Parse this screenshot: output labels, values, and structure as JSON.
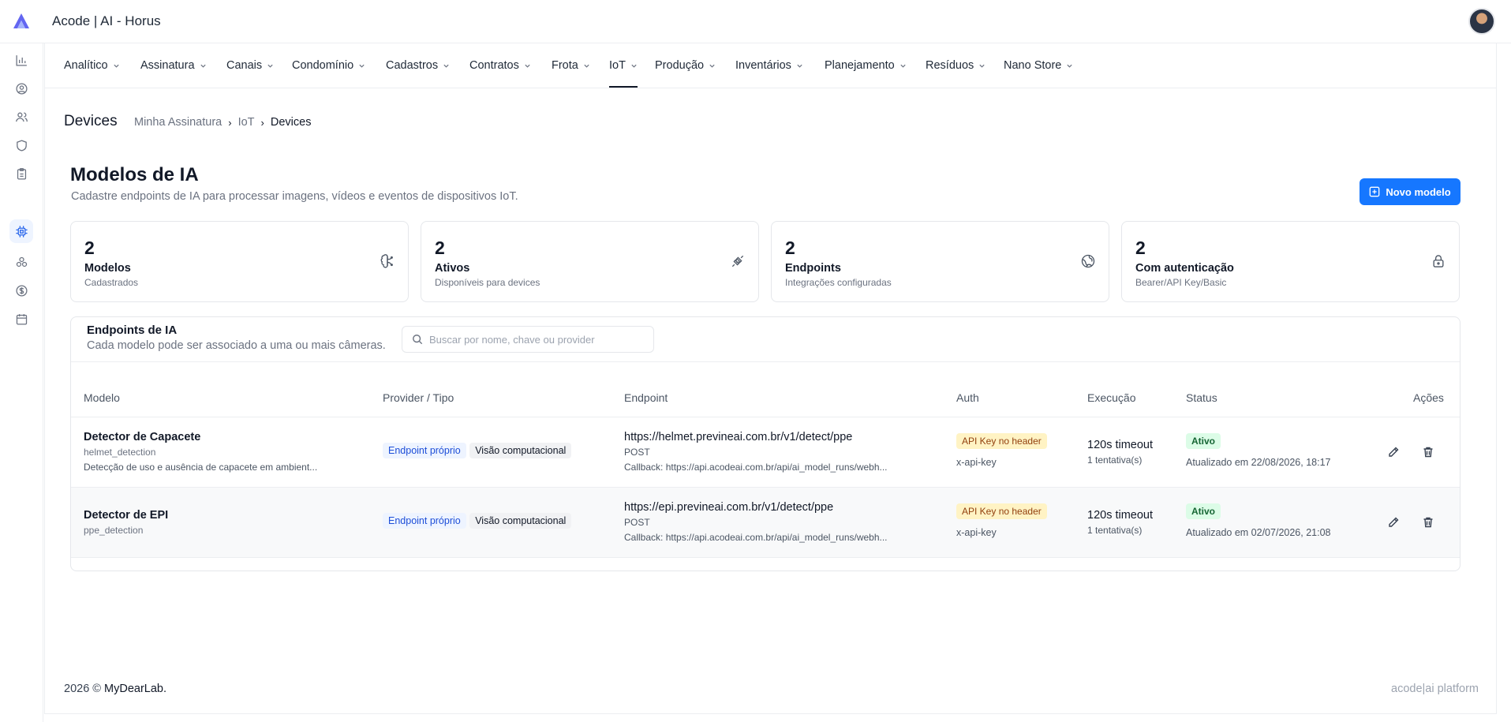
{
  "app": {
    "title": "Acode | AI - Horus"
  },
  "nav": {
    "items": [
      {
        "label": "Analítico"
      },
      {
        "label": "Assinatura"
      },
      {
        "label": "Canais"
      },
      {
        "label": "Condomínio"
      },
      {
        "label": "Cadastros"
      },
      {
        "label": "Contratos"
      },
      {
        "label": "Frota"
      },
      {
        "label": "IoT"
      },
      {
        "label": "Produção"
      },
      {
        "label": "Inventários"
      },
      {
        "label": "Planejamento"
      },
      {
        "label": "Resíduos"
      },
      {
        "label": "Nano Store"
      }
    ],
    "active": "IoT"
  },
  "sidebar": {
    "icons": [
      "bar-chart-icon",
      "user-circle-icon",
      "users-icon",
      "shield-icon",
      "clipboard-icon",
      "cpu-icon",
      "boxes-icon",
      "dollar-icon",
      "calendar-icon"
    ],
    "active": "cpu-icon"
  },
  "page": {
    "title": "Devices",
    "breadcrumb": [
      "Minha Assinatura",
      "IoT",
      "Devices"
    ]
  },
  "section": {
    "title": "Modelos de IA",
    "subtitle": "Cadastre endpoints de IA para processar imagens, vídeos e eventos de dispositivos IoT.",
    "new_button": "Novo modelo"
  },
  "stats": [
    {
      "value": "2",
      "label": "Modelos",
      "desc": "Cadastrados",
      "icon": "brain-icon"
    },
    {
      "value": "2",
      "label": "Ativos",
      "desc": "Disponíveis para devices",
      "icon": "plug-icon"
    },
    {
      "value": "2",
      "label": "Endpoints",
      "desc": "Integrações configuradas",
      "icon": "globe-icon"
    },
    {
      "value": "2",
      "label": "Com autenticação",
      "desc": "Bearer/API Key/Basic",
      "icon": "lock-icon"
    }
  ],
  "table": {
    "title": "Endpoints de IA",
    "subtitle": "Cada modelo pode ser associado a uma ou mais câmeras.",
    "search_placeholder": "Buscar por nome, chave ou provider",
    "columns": [
      "Modelo",
      "Provider / Tipo",
      "Endpoint",
      "Auth",
      "Execução",
      "Status",
      "Ações"
    ],
    "rows": [
      {
        "name": "Detector de Capacete",
        "key": "helmet_detection",
        "desc": "Detecção de uso e ausência de capacete em ambient...",
        "provider": "Endpoint próprio",
        "type": "Visão computacional",
        "url": "https://helmet.previneai.com.br/v1/detect/ppe",
        "method": "POST",
        "callback": "Callback: https://api.acodeai.com.br/api/ai_model_runs/webh...",
        "auth": "API Key no header",
        "auth_key": "x-api-key",
        "timeout": "120s timeout",
        "attempts": "1 tentativa(s)",
        "status": "Ativo",
        "updated": "Atualizado em 22/08/2026, 18:17"
      },
      {
        "name": "Detector de EPI",
        "key": "ppe_detection",
        "desc": "",
        "provider": "Endpoint próprio",
        "type": "Visão computacional",
        "url": "https://epi.previneai.com.br/v1/detect/ppe",
        "method": "POST",
        "callback": "Callback: https://api.acodeai.com.br/api/ai_model_runs/webh...",
        "auth": "API Key no header",
        "auth_key": "x-api-key",
        "timeout": "120s timeout",
        "attempts": "1 tentativa(s)",
        "status": "Ativo",
        "updated": "Atualizado em 02/07/2026, 21:08"
      }
    ]
  },
  "footer": {
    "year": "2026 ©",
    "brand": "MyDearLab.",
    "platform": "acode|ai platform"
  },
  "colors": {
    "accent": "#1677ff",
    "active_tab": "#111827",
    "status_green_bg": "#dcfce7",
    "auth_yellow_bg": "#fff3c4"
  }
}
